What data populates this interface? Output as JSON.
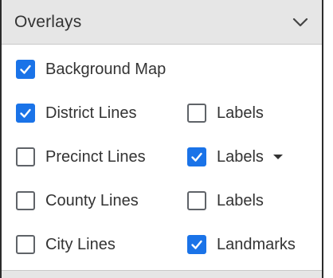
{
  "panel": {
    "title": "Overlays",
    "collapse_icon": "chevron-down-icon"
  },
  "overlays": {
    "background_map": {
      "label": "Background Map",
      "checked": true
    },
    "district_lines": {
      "label": "District Lines",
      "checked": true
    },
    "district_labels": {
      "label": "Labels",
      "checked": false
    },
    "precinct_lines": {
      "label": "Precinct Lines",
      "checked": false
    },
    "precinct_labels": {
      "label": "Labels",
      "checked": true,
      "dropdown_icon": "caret-down-icon"
    },
    "county_lines": {
      "label": "County Lines",
      "checked": false
    },
    "county_labels": {
      "label": "Labels",
      "checked": false
    },
    "city_lines": {
      "label": "City Lines",
      "checked": false
    },
    "landmarks": {
      "label": "Landmarks",
      "checked": true
    }
  },
  "colors": {
    "checkbox_checked": "#1a73e8",
    "checkbox_border": "#5f6368",
    "header_background": "#e6e6e6",
    "text": "#333333"
  }
}
